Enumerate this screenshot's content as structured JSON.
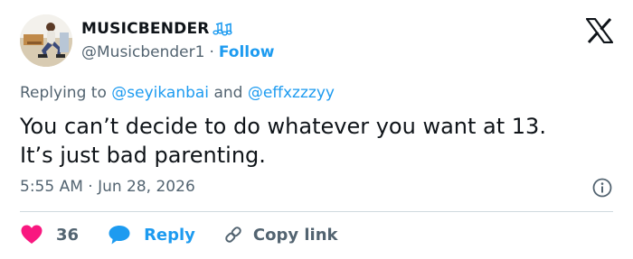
{
  "author": {
    "display_name": "MUSICBENDER",
    "badge_icon": "music-notes-icon",
    "handle": "@Musicbender1",
    "separator": "·",
    "follow_label": "Follow"
  },
  "replying": {
    "prefix": "Replying to",
    "mention_1": "@seyikanbai",
    "conjunction": "and",
    "mention_2": "@effxzzzyy"
  },
  "tweet": {
    "line_1": "You can’t decide to do whatever you want at 13.",
    "line_2": "It’s just bad parenting."
  },
  "timestamp": "5:55 AM · Jun 28, 2026",
  "actions": {
    "likes_count": "36",
    "reply_label": "Reply",
    "copy_label": "Copy link"
  },
  "colors": {
    "accent": "#1d9bf0",
    "heart": "#f91880",
    "text": "#0f1419",
    "muted": "#536471"
  }
}
